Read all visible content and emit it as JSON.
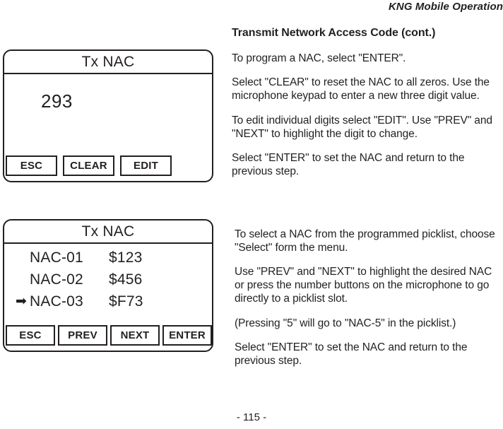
{
  "header": {
    "running_title": "KNG Mobile Operation"
  },
  "section": {
    "title": "Transmit Network Access Code (cont.)"
  },
  "instructions_top": [
    "To program a NAC, select \"ENTER\".",
    "Select \"CLEAR\" to reset the NAC to all zeros. Use the microphone keypad to enter a new three digit value.",
    "To edit individual digits select \"EDIT\". Use \"PREV\" and \"NEXT\" to highlight the digit to change.",
    "Select \"ENTER\" to set the NAC and return to the previous step."
  ],
  "instructions_bottom": [
    "To select a NAC from the programmed picklist, choose \"Select\" form the menu.",
    "Use \"PREV\" and \"NEXT\" to highlight the desired NAC or press the number buttons on the microphone to go directly to a picklist slot.",
    "(Pressing \"5\" will go to \"NAC-5\" in the picklist.)",
    "Select \"ENTER\" to set the NAC and return to the previous step."
  ],
  "lcd_nac_edit": {
    "title": "Tx NAC",
    "value": "293",
    "softkeys": [
      {
        "label": "ESC"
      },
      {
        "label": "CLEAR"
      },
      {
        "label": "EDIT"
      }
    ]
  },
  "lcd_nac_list": {
    "title": "Tx NAC",
    "marker": "➡",
    "rows": [
      {
        "name": "NAC-01",
        "value": "$123",
        "selected": false
      },
      {
        "name": "NAC-02",
        "value": "$456",
        "selected": false
      },
      {
        "name": "NAC-03",
        "value": "$F73",
        "selected": true
      }
    ],
    "softkeys": [
      {
        "label": "ESC"
      },
      {
        "label": "PREV"
      },
      {
        "label": "NEXT"
      },
      {
        "label": "ENTER"
      }
    ]
  },
  "footer": {
    "page_number": "- 115 -"
  },
  "colors": {
    "ink": "#231f20",
    "paper": "#ffffff"
  }
}
